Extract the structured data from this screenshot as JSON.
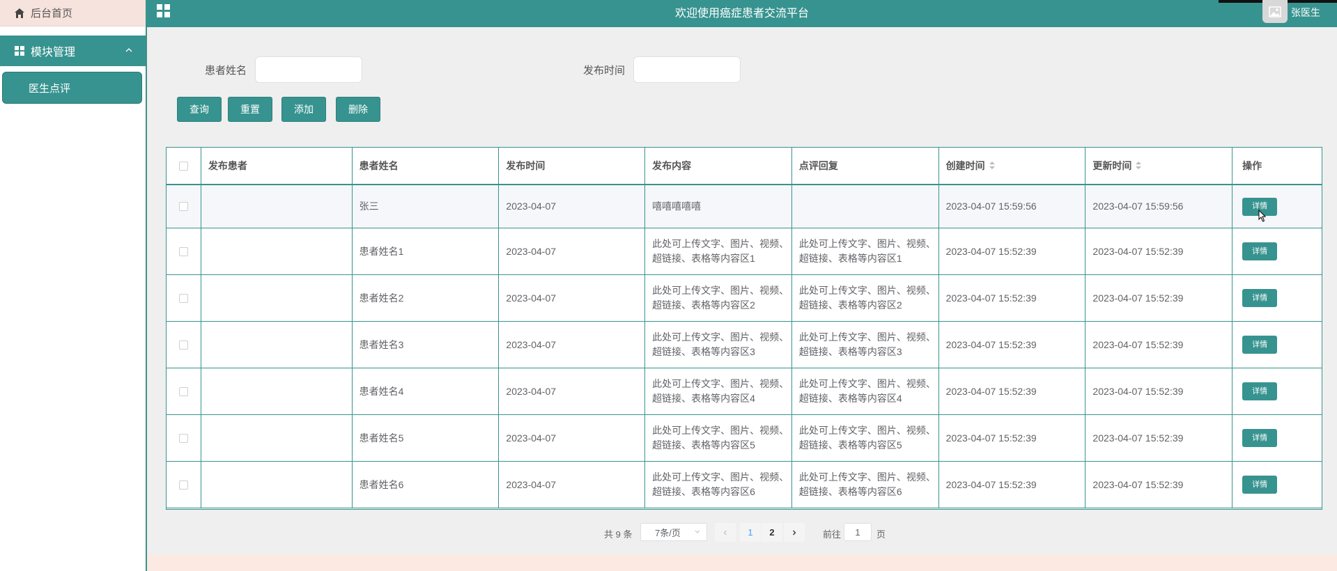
{
  "sidebar": {
    "home_label": "后台首页",
    "module_label": "模块管理",
    "sub_label": "医生点评"
  },
  "header": {
    "title": "欢迎使用癌症患者交流平台",
    "username": "张医生"
  },
  "search": {
    "name_label": "患者姓名",
    "name_value": "",
    "time_label": "发布时间",
    "time_value": ""
  },
  "buttons": {
    "query": "查询",
    "reset": "重置",
    "add": "添加",
    "delete": "删除"
  },
  "table": {
    "headers": [
      "发布患者",
      "患者姓名",
      "发布时间",
      "发布内容",
      "点评回复",
      "创建时间",
      "更新时间",
      "操作"
    ],
    "detail_label": "详情",
    "rows": [
      {
        "publisher": "",
        "name": "张三",
        "time": "2023-04-07",
        "content": "嘻嘻嘻嘻嘻",
        "reply": "",
        "created": "2023-04-07 15:59:56",
        "updated": "2023-04-07 15:59:56"
      },
      {
        "publisher": "",
        "name": "患者姓名1",
        "time": "2023-04-07",
        "content": "此处可上传文字、图片、视频、超链接、表格等内容区1",
        "reply": "此处可上传文字、图片、视频、超链接、表格等内容区1",
        "created": "2023-04-07 15:52:39",
        "updated": "2023-04-07 15:52:39"
      },
      {
        "publisher": "",
        "name": "患者姓名2",
        "time": "2023-04-07",
        "content": "此处可上传文字、图片、视频、超链接、表格等内容区2",
        "reply": "此处可上传文字、图片、视频、超链接、表格等内容区2",
        "created": "2023-04-07 15:52:39",
        "updated": "2023-04-07 15:52:39"
      },
      {
        "publisher": "",
        "name": "患者姓名3",
        "time": "2023-04-07",
        "content": "此处可上传文字、图片、视频、超链接、表格等内容区3",
        "reply": "此处可上传文字、图片、视频、超链接、表格等内容区3",
        "created": "2023-04-07 15:52:39",
        "updated": "2023-04-07 15:52:39"
      },
      {
        "publisher": "",
        "name": "患者姓名4",
        "time": "2023-04-07",
        "content": "此处可上传文字、图片、视频、超链接、表格等内容区4",
        "reply": "此处可上传文字、图片、视频、超链接、表格等内容区4",
        "created": "2023-04-07 15:52:39",
        "updated": "2023-04-07 15:52:39"
      },
      {
        "publisher": "",
        "name": "患者姓名5",
        "time": "2023-04-07",
        "content": "此处可上传文字、图片、视频、超链接、表格等内容区5",
        "reply": "此处可上传文字、图片、视频、超链接、表格等内容区5",
        "created": "2023-04-07 15:52:39",
        "updated": "2023-04-07 15:52:39"
      },
      {
        "publisher": "",
        "name": "患者姓名6",
        "time": "2023-04-07",
        "content": "此处可上传文字、图片、视频、超链接、表格等内容区6",
        "reply": "此处可上传文字、图片、视频、超链接、表格等内容区6",
        "created": "2023-04-07 15:52:39",
        "updated": "2023-04-07 15:52:39"
      }
    ]
  },
  "pagination": {
    "total": "共 9 条",
    "page_size": "7条/页",
    "pages": [
      "1",
      "2"
    ],
    "goto_label": "前往",
    "goto_value": "1",
    "page_unit": "页"
  },
  "colors": {
    "accent": "#37938f",
    "page_bg": "#efefef",
    "outer_bg": "#fbe9e2"
  },
  "icons": [
    "home-icon",
    "grid-icon",
    "chevron-up-icon",
    "apps-icon",
    "image-icon",
    "sort-icon",
    "chevron-left-icon",
    "chevron-right-icon",
    "chevron-down-icon"
  ]
}
